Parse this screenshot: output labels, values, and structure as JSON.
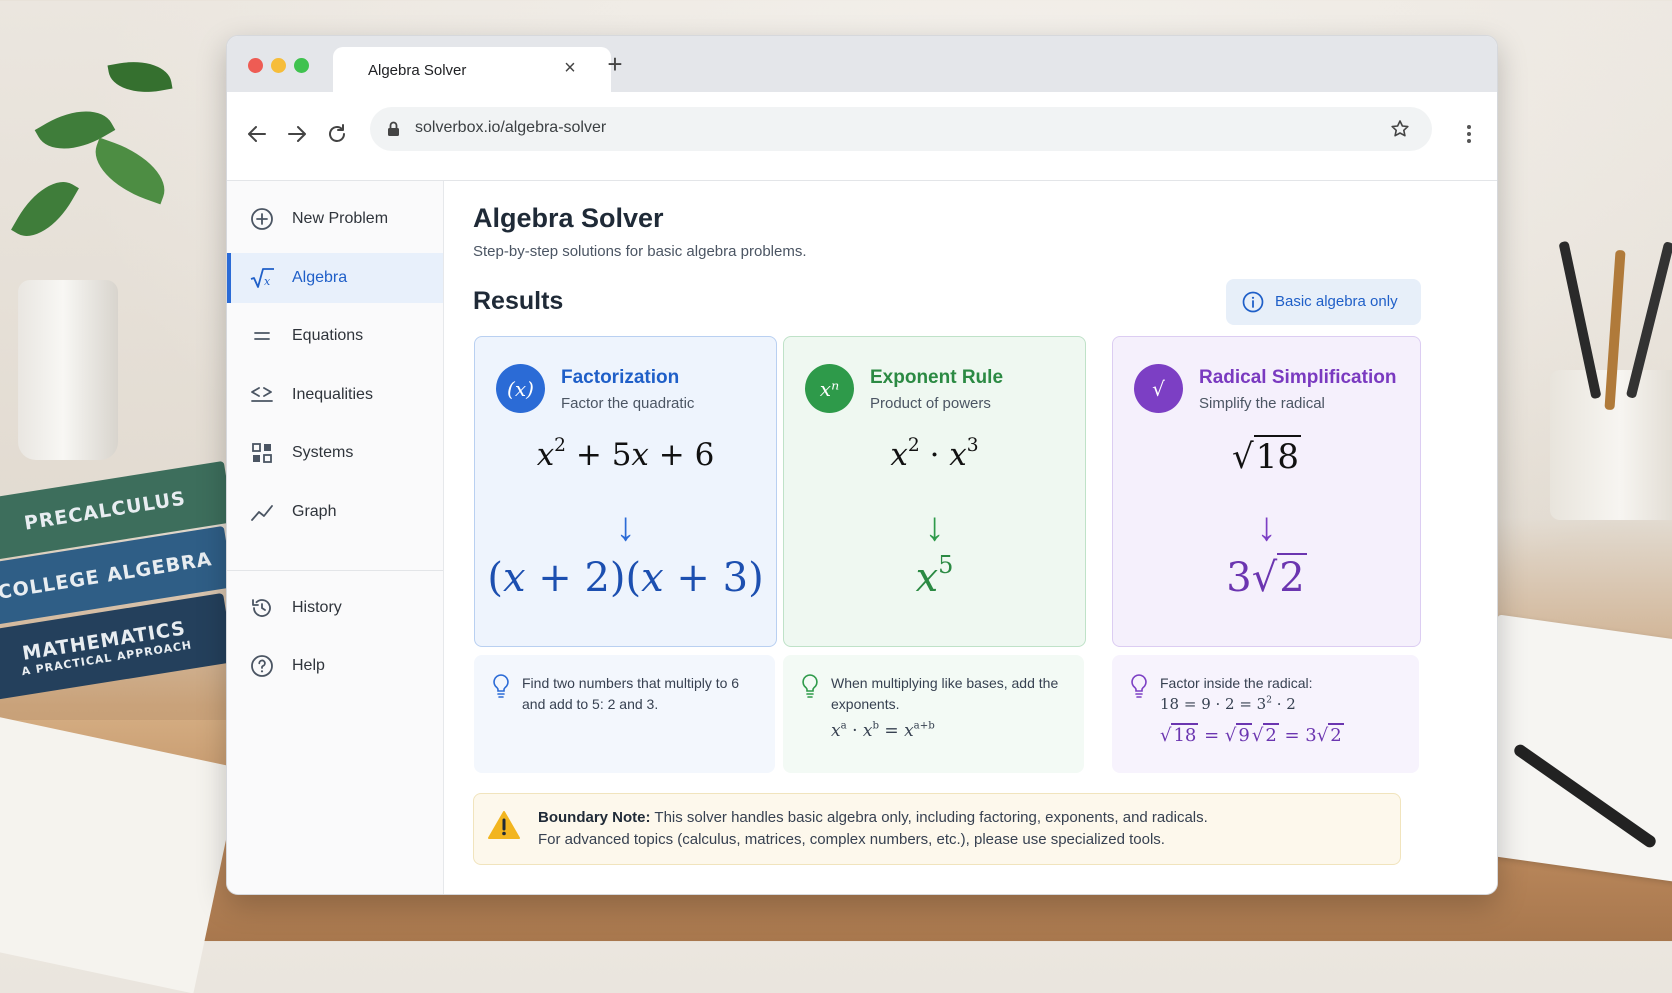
{
  "browser": {
    "tab_title": "Algebra Solver",
    "tab_close": "×",
    "new_tab": "+",
    "url": "solverbox.io/algebra-solver"
  },
  "sidebar": {
    "items": [
      {
        "label": "New Problem",
        "icon": "plus-circle-icon"
      },
      {
        "label": "Algebra",
        "icon": "square-root-icon",
        "active": true
      },
      {
        "label": "Equations",
        "icon": "equals-icon"
      },
      {
        "label": "Inequalities",
        "icon": "inequality-icon"
      },
      {
        "label": "Systems",
        "icon": "grid-icon"
      },
      {
        "label": "Graph",
        "icon": "line-graph-icon"
      },
      {
        "label": "History",
        "icon": "history-icon"
      },
      {
        "label": "Help",
        "icon": "help-circle-icon"
      }
    ]
  },
  "main": {
    "title": "Algebra Solver",
    "subtitle": "Step-by-step solutions for basic algebra problems.",
    "results_heading": "Results",
    "badge": "Basic algebra only",
    "cards": [
      {
        "title": "Factorization",
        "subtitle": "Factor the quadratic",
        "badge_glyph": "(x)",
        "color": "#2b6bd6",
        "tip": "Find two numbers that multiply to 6 and add to 5: 2 and 3."
      },
      {
        "title": "Exponent Rule",
        "subtitle": "Product of powers",
        "badge_glyph": "xⁿ",
        "color": "#2e9a4a",
        "tip": "When multiplying like bases, add the exponents."
      },
      {
        "title": "Radical Simplification",
        "subtitle": "Simplify the radical",
        "badge_glyph": "√",
        "color": "#7c3fc4",
        "tip": "Factor inside the radical:"
      }
    ],
    "note": {
      "label": "Boundary Note:",
      "line1": "This solver handles basic algebra only, including factoring, exponents, and radicals.",
      "line2": "For advanced topics (calculus, matrices, complex numbers, etc.), please use specialized tools."
    }
  },
  "backdrop": {
    "books": [
      "PRECALCULUS",
      "COLLEGE ALGEBRA",
      "MATHEMATICS",
      "A PRACTICAL APPROACH"
    ]
  }
}
